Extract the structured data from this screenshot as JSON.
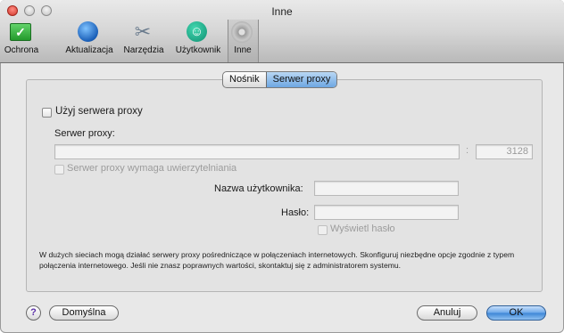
{
  "window": {
    "title": "Inne"
  },
  "toolbar": {
    "items": [
      {
        "label": "Ochrona",
        "icon": "shield-check-icon"
      },
      {
        "label": "Aktualizacja",
        "icon": "globe-icon"
      },
      {
        "label": "Narzędzia",
        "icon": "tools-icon"
      },
      {
        "label": "Użytkownik",
        "icon": "user-icon"
      },
      {
        "label": "Inne",
        "icon": "gear-icon"
      }
    ],
    "selected": "Inne"
  },
  "tabs": {
    "items": [
      "Nośnik",
      "Serwer proxy"
    ],
    "active": "Serwer proxy"
  },
  "proxy": {
    "use_proxy_label": "Użyj serwera proxy",
    "use_proxy_checked": false,
    "server_label": "Serwer proxy:",
    "server_value": "",
    "port_separator": ":",
    "port_value": "3128",
    "auth_required_label": "Serwer proxy wymaga uwierzytelniania",
    "username_label": "Nazwa użytkownika:",
    "username_value": "",
    "password_label": "Hasło:",
    "password_value": "",
    "show_password_label": "Wyświetl hasło",
    "note": "W dużych sieciach mogą działać serwery proxy pośredniczące w połączeniach internetowych. Skonfiguruj niezbędne opcje zgodnie z typem połączenia internetowego. Jeśli nie znasz poprawnych wartości, skontaktuj się z administratorem systemu."
  },
  "footer": {
    "help_label": "?",
    "defaults_label": "Domyślna",
    "cancel_label": "Anuluj",
    "ok_label": "OK"
  },
  "colors": {
    "accent": "#6aa6e8",
    "close": "#d2382c"
  }
}
